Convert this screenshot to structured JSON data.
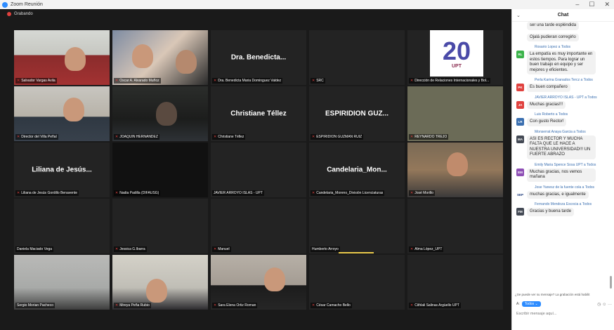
{
  "window": {
    "title": "Zoom Reunión",
    "minimize": "–",
    "maximize": "☐",
    "close": "✕"
  },
  "gallery": {
    "label": "Grabando"
  },
  "tiles": [
    {
      "label": "Salvador Vargas Avila",
      "center": ""
    },
    {
      "label": "Oscar A. Alvarado Muñoz",
      "center": ""
    },
    {
      "label": "Dra. Benedicta Maria Dominguez Valdez",
      "center": "Dra. Benedicta..."
    },
    {
      "label": "SRC",
      "center": ""
    },
    {
      "label": "Dirección de Relaciones Internacionales y Bol...",
      "center": "",
      "logo_num": "20",
      "logo_brand": "UPT"
    },
    {
      "label": "Director del Villa Peñal",
      "center": ""
    },
    {
      "label": "JOAQUIN HERNANDEZ",
      "center": ""
    },
    {
      "label": "Christiane Téllez",
      "center": "Christiane Téllez"
    },
    {
      "label": "ESPIRIDION GUZMAN RUIZ",
      "center": "ESPIRIDION GUZ..."
    },
    {
      "label": "REYNARDO TREJO",
      "center": ""
    },
    {
      "label": "Liliana de Jesús Gordillo Benavente",
      "center": "Liliana de Jesús..."
    },
    {
      "label": "Nadia Padilla (DIFAUSG)",
      "center": ""
    },
    {
      "label": "JAVIER ARROYO ISLAS - UPT",
      "center": ""
    },
    {
      "label": "Candelaria_Moreno_División Licenciaturas",
      "center": "Candelaria_Mon..."
    },
    {
      "label": "José Morillo",
      "center": ""
    },
    {
      "label": "Daniela Maciado Vega",
      "center": ""
    },
    {
      "label": "Jessica G.Ibarra",
      "center": ""
    },
    {
      "label": "Manuel",
      "center": ""
    },
    {
      "label": "Humberto Arroyo",
      "center": ""
    },
    {
      "label": "Alma López_UPT",
      "center": ""
    },
    {
      "label": "Sergio Morian Pacheco",
      "center": ""
    },
    {
      "label": "Mireya Peña Rubio",
      "center": ""
    },
    {
      "label": "Sara Elena Ortiz Roman",
      "center": ""
    },
    {
      "label": "César Camacho Bello",
      "center": ""
    },
    {
      "label": "Cithlali Salinas Argüello UPT",
      "center": ""
    }
  ],
  "chat": {
    "title": "Chat",
    "collapse": "⌄",
    "messages": [
      {
        "from": "",
        "initials": "",
        "color": "",
        "lines": [
          "ser una tarde espléndida"
        ]
      },
      {
        "from": "",
        "initials": "",
        "color": "",
        "lines": [
          "Ojalá pudieran corregirlo"
        ]
      },
      {
        "from": "Rosario Lopez a Todos",
        "initials": "RL",
        "color": "#3bb34a",
        "lines": [
          "La empatía es muy importante en estos tiempos. Para lograr un buen trabajo en equipo y ser mejores y eficientes."
        ]
      },
      {
        "from": "Perla Karina Granados Tercz a Todos",
        "initials": "PK",
        "color": "#e0413e",
        "lines": [
          "Es buen compañero"
        ]
      },
      {
        "from": "JAVIER ARROYO ISLAS - UPT a Todos",
        "initials": "JA",
        "color": "#e0413e",
        "lines": [
          "Muchas gracias!!!"
        ]
      },
      {
        "from": "Luis Roberto a Todos",
        "initials": "LR",
        "color": "#3a6fb0",
        "lines": [
          "Con gusto Rector!"
        ]
      },
      {
        "from": "Monserrat Anaya Garcia a Todos",
        "initials": "MA",
        "color": "#444a55",
        "lines": [
          "ASI ES RECTOR Y MUCHA FALTA QUE LE HACE A NUESTRA UNIVERSIDAD!!! UN FUERTE ABRAZO"
        ]
      },
      {
        "from": "Emily Maria Spence Sosa UPT a Todos",
        "initials": "EM",
        "color": "#8e4fb5",
        "lines": [
          "Muchas gracias, nos vemos mañana"
        ]
      },
      {
        "from": "Jose Yanesz de la fuente cola a Todos",
        "initials": "SEP",
        "color": "#ffffff",
        "lines": [
          "muchas gracias, e igualmente"
        ]
      },
      {
        "from": "Fernando Mendoza Escocia a Todos",
        "initials": "FM",
        "color": "#444a55",
        "lines": [
          "Gracias y buena tarde"
        ]
      }
    ],
    "notice": "¿Se puede ver su mensaje? La grabación está habilit",
    "to_label": "A:",
    "to_value": "Todos ⌄",
    "icons": "◷ ☺ ···",
    "input_placeholder": "Escribir mensaje aquí..."
  }
}
